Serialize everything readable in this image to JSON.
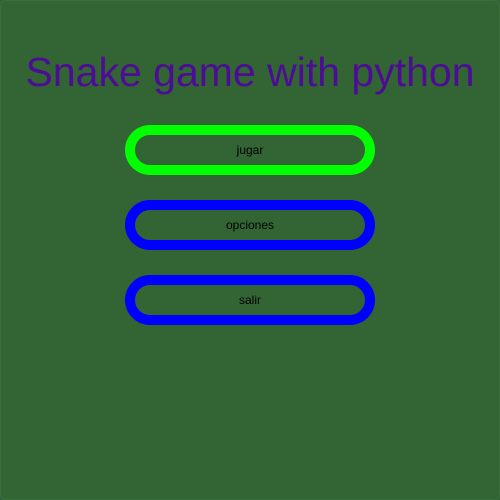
{
  "title": "Snake game with python",
  "menu": {
    "items": [
      {
        "label": "jugar",
        "selected": true
      },
      {
        "label": "opciones",
        "selected": false
      },
      {
        "label": "salir",
        "selected": false
      }
    ]
  },
  "colors": {
    "background": "#326434",
    "title": "#4d0c95",
    "button_border": "#0000ff",
    "button_border_selected": "#00ff00",
    "button_text": "#000000"
  }
}
